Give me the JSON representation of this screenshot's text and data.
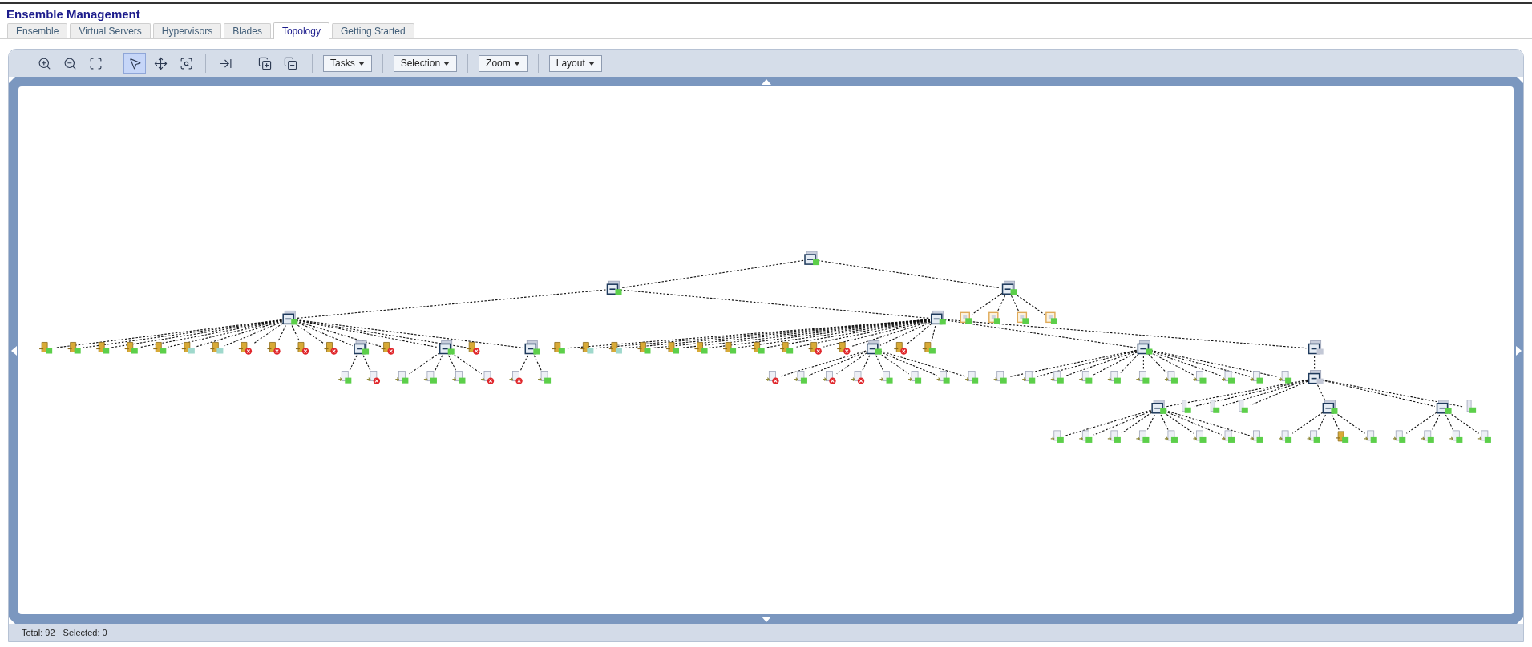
{
  "header": {
    "title": "Ensemble Management"
  },
  "tabs": [
    {
      "label": "Ensemble",
      "selected": false
    },
    {
      "label": "Virtual Servers",
      "selected": false
    },
    {
      "label": "Hypervisors",
      "selected": false
    },
    {
      "label": "Blades",
      "selected": false
    },
    {
      "label": "Topology",
      "selected": true
    },
    {
      "label": "Getting Started",
      "selected": false
    }
  ],
  "toolbar": {
    "tools": [
      {
        "kind": "zoom-in",
        "selected": false
      },
      {
        "kind": "zoom-out",
        "selected": false
      },
      {
        "kind": "zoom-fit",
        "selected": false
      },
      {
        "kind": "separator"
      },
      {
        "kind": "pointer",
        "selected": true
      },
      {
        "kind": "pan",
        "selected": false
      },
      {
        "kind": "zoom-region",
        "selected": false
      },
      {
        "kind": "separator"
      },
      {
        "kind": "fit-panel",
        "selected": false
      },
      {
        "kind": "separator"
      },
      {
        "kind": "expand-all",
        "selected": false
      },
      {
        "kind": "collapse-all",
        "selected": false
      }
    ],
    "menus": [
      "Tasks",
      "Selection",
      "Zoom",
      "Layout"
    ]
  },
  "topology": {
    "root": {
      "kind": "group",
      "color": "#5ccf4a",
      "error": false,
      "children": [
        {
          "kind": "group",
          "color": "#5ccf4a",
          "error": false,
          "children": [
            {
              "kind": "group",
              "color": "#5ccf4a",
              "error": false,
              "children": [
                {
                  "kind": "hypervisor",
                  "color": "#5ccf4a",
                  "error": false
                },
                {
                  "kind": "hypervisor",
                  "color": "#5ccf4a",
                  "error": false
                },
                {
                  "kind": "hypervisor",
                  "color": "#5ccf4a",
                  "error": false
                },
                {
                  "kind": "hypervisor",
                  "color": "#5ccf4a",
                  "error": false
                },
                {
                  "kind": "hypervisor",
                  "color": "#5ccf4a",
                  "error": false
                },
                {
                  "kind": "hypervisor",
                  "color": "#9fd8cc",
                  "error": false
                },
                {
                  "kind": "hypervisor",
                  "color": "#9fd8cc",
                  "error": false
                },
                {
                  "kind": "hypervisor",
                  "color": "#e0262b",
                  "error": true
                },
                {
                  "kind": "hypervisor",
                  "color": "#e0262b",
                  "error": true
                },
                {
                  "kind": "hypervisor",
                  "color": "#e0262b",
                  "error": true
                },
                {
                  "kind": "hypervisor",
                  "color": "#e0262b",
                  "error": true
                },
                {
                  "kind": "group",
                  "color": "#5ccf4a",
                  "error": false,
                  "children": [
                    {
                      "kind": "virtual-server",
                      "color": "#5ccf4a",
                      "error": false
                    },
                    {
                      "kind": "virtual-server",
                      "color": "#e0262b",
                      "error": true
                    }
                  ]
                },
                {
                  "kind": "hypervisor",
                  "color": "#e0262b",
                  "error": true
                },
                {
                  "kind": "group",
                  "color": "#5ccf4a",
                  "error": false,
                  "children": [
                    {
                      "kind": "virtual-server",
                      "color": "#5ccf4a",
                      "error": false
                    },
                    {
                      "kind": "virtual-server",
                      "color": "#5ccf4a",
                      "error": false
                    },
                    {
                      "kind": "virtual-server",
                      "color": "#5ccf4a",
                      "error": false
                    },
                    {
                      "kind": "virtual-server",
                      "color": "#e0262b",
                      "error": true
                    }
                  ]
                },
                {
                  "kind": "hypervisor",
                  "color": "#e0262b",
                  "error": true
                },
                {
                  "kind": "group",
                  "color": "#5ccf4a",
                  "error": false,
                  "children": [
                    {
                      "kind": "virtual-server",
                      "color": "#e0262b",
                      "error": true
                    },
                    {
                      "kind": "virtual-server",
                      "color": "#5ccf4a",
                      "error": false
                    }
                  ]
                }
              ]
            },
            {
              "kind": "group",
              "color": "#5ccf4a",
              "error": false,
              "children": [
                {
                  "kind": "hypervisor",
                  "color": "#5ccf4a",
                  "error": false
                },
                {
                  "kind": "hypervisor",
                  "color": "#9fd8cc",
                  "error": false
                },
                {
                  "kind": "hypervisor",
                  "color": "#9fd8cc",
                  "error": false
                },
                {
                  "kind": "hypervisor",
                  "color": "#5ccf4a",
                  "error": false
                },
                {
                  "kind": "hypervisor",
                  "color": "#5ccf4a",
                  "error": false
                },
                {
                  "kind": "hypervisor",
                  "color": "#5ccf4a",
                  "error": false
                },
                {
                  "kind": "hypervisor",
                  "color": "#5ccf4a",
                  "error": false
                },
                {
                  "kind": "hypervisor",
                  "color": "#5ccf4a",
                  "error": false
                },
                {
                  "kind": "hypervisor",
                  "color": "#5ccf4a",
                  "error": false
                },
                {
                  "kind": "hypervisor",
                  "color": "#e0262b",
                  "error": true
                },
                {
                  "kind": "hypervisor",
                  "color": "#e0262b",
                  "error": true
                },
                {
                  "kind": "group",
                  "color": "#5ccf4a",
                  "error": false,
                  "children": [
                    {
                      "kind": "virtual-server",
                      "color": "#e0262b",
                      "error": true
                    },
                    {
                      "kind": "virtual-server",
                      "color": "#5ccf4a",
                      "error": false
                    },
                    {
                      "kind": "virtual-server",
                      "color": "#e0262b",
                      "error": true
                    },
                    {
                      "kind": "virtual-server",
                      "color": "#e0262b",
                      "error": true
                    },
                    {
                      "kind": "virtual-server",
                      "color": "#5ccf4a",
                      "error": false
                    },
                    {
                      "kind": "virtual-server",
                      "color": "#5ccf4a",
                      "error": false
                    },
                    {
                      "kind": "virtual-server",
                      "color": "#5ccf4a",
                      "error": false
                    },
                    {
                      "kind": "virtual-server",
                      "color": "#5ccf4a",
                      "error": false
                    }
                  ]
                },
                {
                  "kind": "hypervisor",
                  "color": "#e0262b",
                  "error": true
                },
                {
                  "kind": "hypervisor",
                  "color": "#5ccf4a",
                  "error": false
                },
                {
                  "kind": "group",
                  "color": "#5ccf4a",
                  "error": false,
                  "children": [
                    {
                      "kind": "virtual-server",
                      "color": "#5ccf4a",
                      "error": false
                    },
                    {
                      "kind": "virtual-server",
                      "color": "#5ccf4a",
                      "error": false
                    },
                    {
                      "kind": "virtual-server",
                      "color": "#5ccf4a",
                      "error": false
                    },
                    {
                      "kind": "virtual-server",
                      "color": "#5ccf4a",
                      "error": false
                    },
                    {
                      "kind": "virtual-server",
                      "color": "#5ccf4a",
                      "error": false
                    },
                    {
                      "kind": "virtual-server",
                      "color": "#5ccf4a",
                      "error": false
                    },
                    {
                      "kind": "virtual-server",
                      "color": "#5ccf4a",
                      "error": false
                    },
                    {
                      "kind": "virtual-server",
                      "color": "#5ccf4a",
                      "error": false
                    },
                    {
                      "kind": "virtual-server",
                      "color": "#5ccf4a",
                      "error": false
                    },
                    {
                      "kind": "virtual-server",
                      "color": "#5ccf4a",
                      "error": false
                    },
                    {
                      "kind": "virtual-server",
                      "color": "#5ccf4a",
                      "error": false
                    }
                  ]
                },
                {
                  "kind": "group",
                  "color": "#c3c8d6",
                  "error": false,
                  "children": [
                    {
                      "kind": "group",
                      "color": "#c3c8d6",
                      "error": false,
                      "children": [
                        {
                          "kind": "group",
                          "color": "#5ccf4a",
                          "error": false,
                          "children": [
                            {
                              "kind": "virtual-server",
                              "color": "#5ccf4a",
                              "error": false
                            },
                            {
                              "kind": "virtual-server",
                              "color": "#5ccf4a",
                              "error": false
                            },
                            {
                              "kind": "virtual-server",
                              "color": "#5ccf4a",
                              "error": false
                            },
                            {
                              "kind": "virtual-server",
                              "color": "#5ccf4a",
                              "error": false
                            },
                            {
                              "kind": "virtual-server",
                              "color": "#5ccf4a",
                              "error": false
                            },
                            {
                              "kind": "virtual-server",
                              "color": "#5ccf4a",
                              "error": false
                            },
                            {
                              "kind": "virtual-server",
                              "color": "#5ccf4a",
                              "error": false
                            },
                            {
                              "kind": "virtual-server",
                              "color": "#5ccf4a",
                              "error": false
                            }
                          ]
                        },
                        {
                          "kind": "blade",
                          "color": "#5ccf4a",
                          "error": false
                        },
                        {
                          "kind": "blade",
                          "color": "#5ccf4a",
                          "error": false
                        },
                        {
                          "kind": "blade",
                          "color": "#5ccf4a",
                          "error": false
                        },
                        {
                          "kind": "group",
                          "color": "#5ccf4a",
                          "error": false,
                          "children": [
                            {
                              "kind": "virtual-server",
                              "color": "#5ccf4a",
                              "error": false
                            },
                            {
                              "kind": "virtual-server",
                              "color": "#5ccf4a",
                              "error": false
                            },
                            {
                              "kind": "hypervisor",
                              "color": "#5ccf4a",
                              "error": false
                            },
                            {
                              "kind": "virtual-server",
                              "color": "#5ccf4a",
                              "error": false
                            }
                          ]
                        },
                        {
                          "kind": "group",
                          "color": "#5ccf4a",
                          "error": false,
                          "children": [
                            {
                              "kind": "virtual-server",
                              "color": "#5ccf4a",
                              "error": false
                            },
                            {
                              "kind": "virtual-server",
                              "color": "#5ccf4a",
                              "error": false
                            },
                            {
                              "kind": "virtual-server",
                              "color": "#5ccf4a",
                              "error": false
                            },
                            {
                              "kind": "virtual-server",
                              "color": "#5ccf4a",
                              "error": false
                            }
                          ]
                        },
                        {
                          "kind": "blade",
                          "color": "#5ccf4a",
                          "error": false
                        }
                      ]
                    }
                  ]
                }
              ]
            }
          ]
        },
        {
          "kind": "group",
          "color": "#5ccf4a",
          "error": false,
          "children": [
            {
              "kind": "frame",
              "color": "#5ccf4a",
              "error": false
            },
            {
              "kind": "frame",
              "color": "#5ccf4a",
              "error": false
            },
            {
              "kind": "frame",
              "color": "#5ccf4a",
              "error": false
            },
            {
              "kind": "frame",
              "color": "#5ccf4a",
              "error": false
            }
          ]
        }
      ]
    }
  },
  "status_bar": {
    "total": "Total: 92",
    "selected": "Selected: 0"
  }
}
